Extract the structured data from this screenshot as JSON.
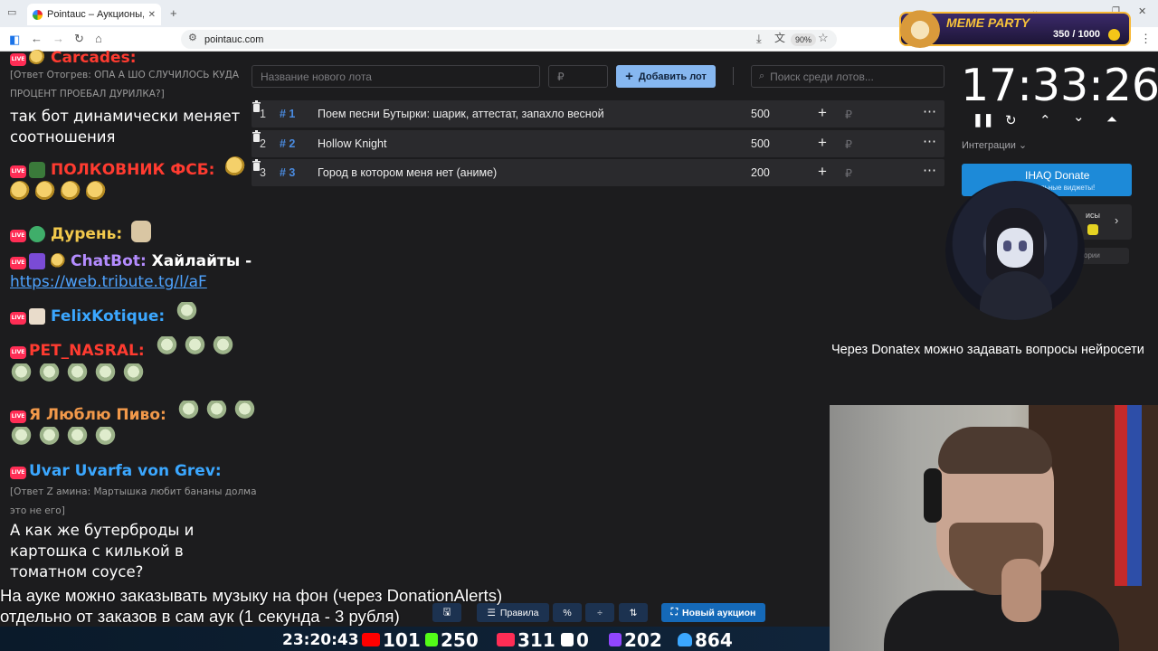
{
  "browser": {
    "tab_title": "Pointauc – Аукционы, лотереи",
    "url": "pointauc.com",
    "zoom": "90%"
  },
  "meme_party": {
    "title": "MEME PARTY",
    "counter": "350 / 1000"
  },
  "auction": {
    "new_lot_placeholder": "Название нового лота",
    "amount_placeholder": "₽",
    "add_lot_label": "Добавить лот",
    "search_placeholder": "Поиск среди лотов...",
    "lots": [
      {
        "index": "1",
        "id": "# 1",
        "name": "Поем песни Бутырки: шарик, аттестат, запахло весной",
        "amount": "500",
        "currency": "₽"
      },
      {
        "index": "2",
        "id": "# 2",
        "name": "Hollow Knight",
        "amount": "500",
        "currency": "₽"
      },
      {
        "index": "3",
        "id": "# 3",
        "name": "Город в котором меня нет (аниме)",
        "amount": "200",
        "currency": "₽"
      }
    ]
  },
  "timer": {
    "value": "17:33:26"
  },
  "integrations": {
    "label": "Интеграции",
    "ihaq_title": "IHAQ Donate",
    "ihaq_sub": "уникальные виджеты!",
    "card2_text": "исы",
    "card3_text": "ории"
  },
  "overlay_note": "Через Donatex можно задавать вопросы нейросети",
  "chat": {
    "lines": [
      {
        "user": "Carcades:",
        "color": "#ff3b30"
      },
      {
        "reply": "[Ответ Отогрев: ОПА А ШО СЛУЧИЛОСЬ КУДА",
        "reply2": "ПРОЦЕНТ ПРОЕБАЛ ДУРИЛКА?]"
      },
      {
        "text": "так бот динамически меняет",
        "text2": "соотношения"
      },
      {
        "user": "ПОЛКОВНИК ФСБ:",
        "color": "#ff3b30"
      },
      {
        "user": "Дурень:",
        "color": "#f2c94c"
      },
      {
        "user": "ChatBot:",
        "color": "#b48cff",
        "text": "Хайлайты -",
        "link": "https://web.tribute.tg/l/aF"
      },
      {
        "user": "FelixKotique:",
        "color": "#3ba7ff"
      },
      {
        "user": "PET_NASRAL:",
        "color": "#ff3b30"
      },
      {
        "user": "Я Люблю Пиво:",
        "color": "#f2994a"
      },
      {
        "user": "Uvar Uvarfa von Grev:",
        "color": "#3ba7ff"
      },
      {
        "reply": "[Ответ Z амина: Мартышка любит бананы долма",
        "reply2": "это не его]"
      },
      {
        "text": "А как же бутерброды и",
        "text2": "картошка с килькой в",
        "text3": "томатном соусе?"
      }
    ]
  },
  "bottom_overlay": {
    "line1": "На ауке можно заказывать музыку на фон (через DonationAlerts)",
    "line2": "отдельно от заказов в сам аук (1 секунда - 3 рубля)"
  },
  "bottom_buttons": {
    "rules": "Правила",
    "new_auction": "Новый аукцион"
  },
  "stats": {
    "clock": "23:20:43",
    "youtube": "101",
    "kick": "250",
    "vk_live": "311",
    "rumble": "0",
    "twitch": "202",
    "total": "864"
  }
}
